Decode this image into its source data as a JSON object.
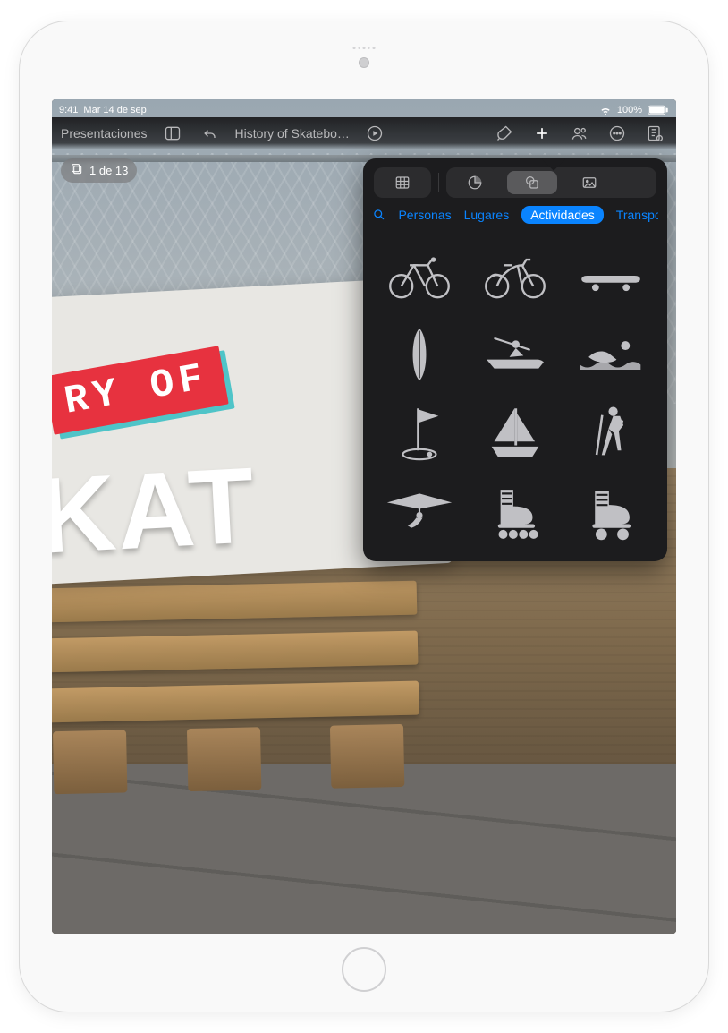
{
  "status": {
    "time": "9:41",
    "date": "Mar 14 de sep",
    "battery": "100%"
  },
  "toolbar": {
    "back": "Presentaciones",
    "title": "History of Skatebo…"
  },
  "slide_counter": {
    "text": "1 de 13"
  },
  "slide": {
    "red": "RY OF",
    "big": "KAT"
  },
  "popover": {
    "segments": [
      "table",
      "chart",
      "shapes",
      "media"
    ],
    "active_segment": "shapes",
    "categories": {
      "items": [
        "Personas",
        "Lugares",
        "Actividades",
        "Transporte"
      ],
      "active": "Actividades"
    },
    "shapes": [
      {
        "name": "bicycle-icon"
      },
      {
        "name": "city-bicycle-icon"
      },
      {
        "name": "skateboard-icon"
      },
      {
        "name": "surfboard-icon"
      },
      {
        "name": "rowing-icon"
      },
      {
        "name": "swimmer-icon"
      },
      {
        "name": "golf-flag-icon"
      },
      {
        "name": "sailboat-icon"
      },
      {
        "name": "hiker-icon"
      },
      {
        "name": "hang-glider-icon"
      },
      {
        "name": "roller-blade-icon"
      },
      {
        "name": "roller-skate-icon"
      }
    ]
  }
}
